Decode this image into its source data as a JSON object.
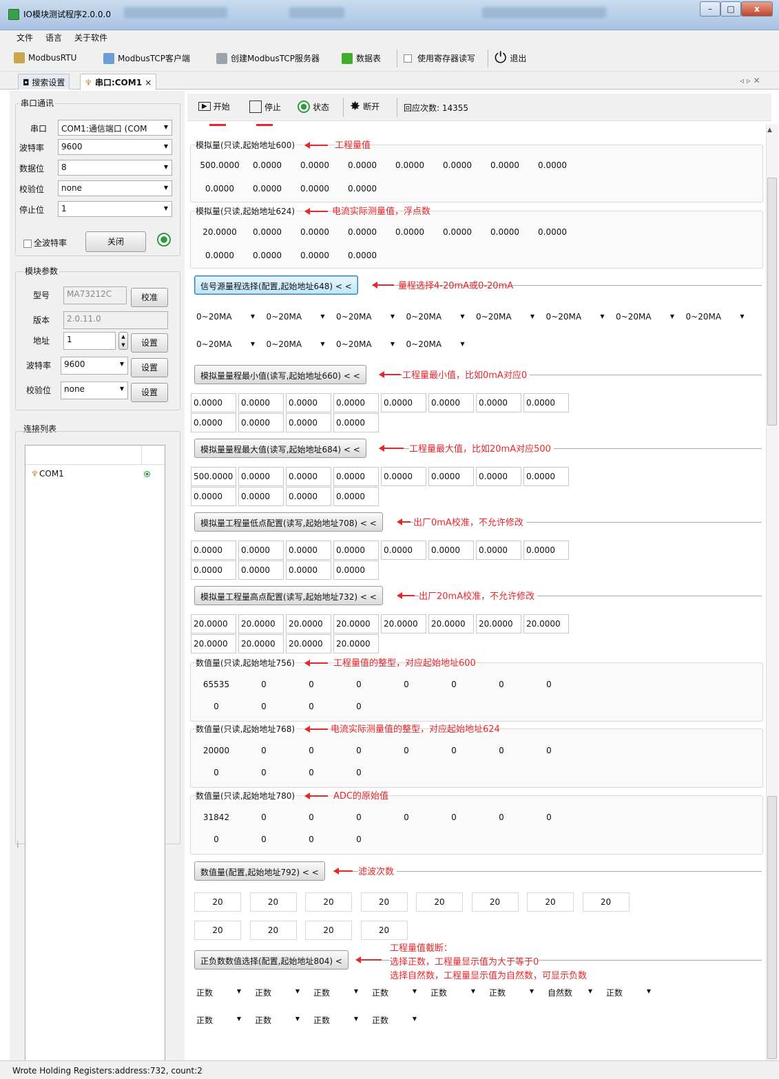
{
  "window": {
    "title": "IO模块测试程序2.0.0.0",
    "minimize": "–",
    "maximize": "□",
    "close": "x"
  },
  "menu": [
    "文件",
    "语言",
    "关于软件"
  ],
  "toolbar": {
    "modbusrtu": "ModbusRTU",
    "tcp_client": "ModbusTCP客户端",
    "tcp_server": "创建ModbusTCP服务器",
    "datatable": "数据表",
    "use_register": "使用寄存器读写",
    "exit": "退出"
  },
  "tabs": {
    "search": "搜索设置",
    "com": "串口:COM1",
    "close": "×",
    "nav": "◃ ▹ ✕"
  },
  "serial": {
    "title": "串口通讯",
    "port_label": "串口",
    "port_value": "COM1:通信端口 (COM",
    "baud_label": "波特率",
    "baud_value": "9600",
    "databits_label": "数据位",
    "databits_value": "8",
    "parity_label": "校验位",
    "parity_value": "none",
    "stopbits_label": "停止位",
    "stopbits_value": "1",
    "allbaud_label": "全波特率",
    "close_button": "关闭"
  },
  "module": {
    "title": "模块参数",
    "model_label": "型号",
    "model_value": "MA73212C",
    "calibrate_button": "校准",
    "version_label": "版本",
    "version_value": "2.0.11.0",
    "address_label": "地址",
    "address_value": "1",
    "set_button": "设置",
    "baud_label": "波特率",
    "baud_value": "9600",
    "parity_label": "校验位",
    "parity_value": "none"
  },
  "connections": {
    "title": "连接列表",
    "items": [
      {
        "name": "COM1"
      }
    ],
    "collapsed_label": "i"
  },
  "run": {
    "start": "开始",
    "stop": "停止",
    "status": "状态",
    "disconnect": "断开",
    "reply_count": "回应次数: 14355"
  },
  "sections": {
    "s600": {
      "title": "模拟量(只读,起始地址600)",
      "note": "工程量值",
      "row1": [
        "500.0000",
        "0.0000",
        "0.0000",
        "0.0000",
        "0.0000",
        "0.0000",
        "0.0000",
        "0.0000"
      ],
      "row2": [
        "0.0000",
        "0.0000",
        "0.0000",
        "0.0000"
      ]
    },
    "s624": {
      "title": "模拟量(只读,起始地址624)",
      "note": "电流实际测量值，浮点数",
      "row1": [
        "20.0000",
        "0.0000",
        "0.0000",
        "0.0000",
        "0.0000",
        "0.0000",
        "0.0000",
        "0.0000"
      ],
      "row2": [
        "0.0000",
        "0.0000",
        "0.0000",
        "0.0000"
      ]
    },
    "s648": {
      "button": "信号源量程选择(配置,起始地址648) < <",
      "note": "量程选择4-20mA或0-20mA",
      "row1": [
        "0~20MA",
        "0~20MA",
        "0~20MA",
        "0~20MA",
        "0~20MA",
        "0~20MA",
        "0~20MA",
        "0~20MA"
      ],
      "row2": [
        "0~20MA",
        "0~20MA",
        "0~20MA",
        "0~20MA"
      ]
    },
    "s660": {
      "button": "模拟量量程最小值(读写,起始地址660) < <",
      "note": "工程量最小值，比如0mA对应0",
      "row1": [
        "0.0000",
        "0.0000",
        "0.0000",
        "0.0000",
        "0.0000",
        "0.0000",
        "0.0000",
        "0.0000"
      ],
      "row2": [
        "0.0000",
        "0.0000",
        "0.0000",
        "0.0000"
      ]
    },
    "s684": {
      "button": "模拟量量程最大值(读写,起始地址684) < <",
      "note": "工程量最大值，比如20mA对应500",
      "row1": [
        "500.0000",
        "0.0000",
        "0.0000",
        "0.0000",
        "0.0000",
        "0.0000",
        "0.0000",
        "0.0000"
      ],
      "row2": [
        "0.0000",
        "0.0000",
        "0.0000",
        "0.0000"
      ]
    },
    "s708": {
      "button": "模拟量工程量低点配置(读写,起始地址708) < <",
      "note": "出厂0mA校准，不允许修改",
      "row1": [
        "0.0000",
        "0.0000",
        "0.0000",
        "0.0000",
        "0.0000",
        "0.0000",
        "0.0000",
        "0.0000"
      ],
      "row2": [
        "0.0000",
        "0.0000",
        "0.0000",
        "0.0000"
      ]
    },
    "s732": {
      "button": "模拟量工程量高点配置(读写,起始地址732) < <",
      "note": "出厂20mA校准，不允许修改",
      "row1": [
        "20.0000",
        "20.0000",
        "20.0000",
        "20.0000",
        "20.0000",
        "20.0000",
        "20.0000",
        "20.0000"
      ],
      "row2": [
        "20.0000",
        "20.0000",
        "20.0000",
        "20.0000"
      ]
    },
    "s756": {
      "title": "数值量(只读,起始地址756)",
      "note": "工程量值的整型，对应起始地址600",
      "row1": [
        "65535",
        "0",
        "0",
        "0",
        "0",
        "0",
        "0",
        "0"
      ],
      "row2": [
        "0",
        "0",
        "0",
        "0"
      ]
    },
    "s768": {
      "title": "数值量(只读,起始地址768)",
      "note": "电流实际测量值的整型，对应起始地址624",
      "row1": [
        "20000",
        "0",
        "0",
        "0",
        "0",
        "0",
        "0",
        "0"
      ],
      "row2": [
        "0",
        "0",
        "0",
        "0"
      ]
    },
    "s780": {
      "title": "数值量(只读,起始地址780)",
      "note": "ADC的原始值",
      "row1": [
        "31842",
        "0",
        "0",
        "0",
        "0",
        "0",
        "0",
        "0"
      ],
      "row2": [
        "0",
        "0",
        "0",
        "0"
      ]
    },
    "s792": {
      "button": "数值量(配置,起始地址792) < <",
      "note": "滤波次数",
      "row1": [
        "20",
        "20",
        "20",
        "20",
        "20",
        "20",
        "20",
        "20"
      ],
      "row2": [
        "20",
        "20",
        "20",
        "20"
      ]
    },
    "s804": {
      "button": "正负数数值选择(配置,起始地址804) <",
      "note1": "工程量值截断：",
      "note2": "选择正数，工程量显示值为大于等于0",
      "note3": "选择自然数，工程量显示值为自然数，可显示负数",
      "row1": [
        "正数",
        "正数",
        "正数",
        "正数",
        "正数",
        "正数",
        "自然数",
        "正数"
      ],
      "row2": [
        "正数",
        "正数",
        "正数",
        "正数"
      ]
    }
  },
  "status": "Wrote Holding Registers:address:732, count:2",
  "colors": {
    "annotation": "#e8262a",
    "status_green": "#2e9a3e"
  }
}
